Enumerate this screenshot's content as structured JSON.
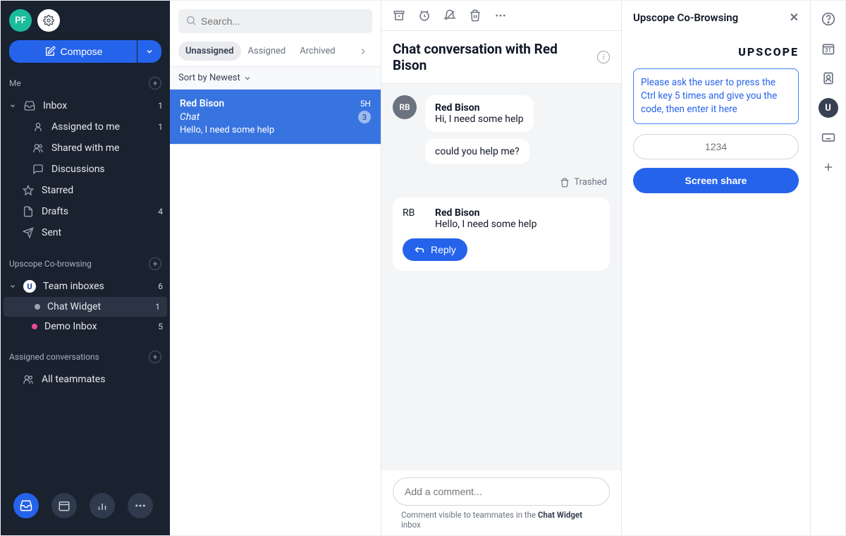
{
  "user": {
    "initials": "PF"
  },
  "compose": {
    "label": "Compose"
  },
  "sections": {
    "me": {
      "title": "Me"
    },
    "cobrowse": {
      "title": "Upscope Co-browsing"
    },
    "assigned": {
      "title": "Assigned conversations"
    }
  },
  "nav": {
    "inbox": {
      "label": "Inbox",
      "count": "1"
    },
    "assigned_to_me": {
      "label": "Assigned to me",
      "count": "1"
    },
    "shared_with_me": {
      "label": "Shared with me"
    },
    "discussions": {
      "label": "Discussions"
    },
    "starred": {
      "label": "Starred"
    },
    "drafts": {
      "label": "Drafts",
      "count": "4"
    },
    "sent": {
      "label": "Sent"
    },
    "team_inboxes": {
      "label": "Team inboxes",
      "count": "6"
    },
    "chat_widget": {
      "label": "Chat Widget",
      "count": "1"
    },
    "demo_inbox": {
      "label": "Demo Inbox",
      "count": "5"
    },
    "all_teammates": {
      "label": "All teammates"
    }
  },
  "list": {
    "search_placeholder": "Search...",
    "tabs": {
      "unassigned": "Unassigned",
      "assigned": "Assigned",
      "archived": "Archived"
    },
    "sort_label": "Sort by Newest",
    "items": [
      {
        "name": "Red Bison",
        "time": "5H",
        "channel": "Chat",
        "badge": "3",
        "preview": "Hello, I need some help"
      }
    ]
  },
  "conversation": {
    "title": "Chat conversation with Red Bison",
    "trashed_label": "Trashed",
    "m1": {
      "sender": "Red Bison",
      "avatar": "RB",
      "text": "Hi, I need some help"
    },
    "m1_followup": "could you help me?",
    "m2": {
      "sender": "Red Bison",
      "avatar": "RB",
      "text": "Hello, I need some help"
    },
    "reply_label": "Reply",
    "comment_placeholder": "Add a comment...",
    "footer_hint_pre": "Comment visible to teammates in the ",
    "footer_hint_bold": "Chat Widget",
    "footer_hint_post": " inbox"
  },
  "upscope": {
    "title": "Upscope Co-Browsing",
    "logo": "UPSCOPE",
    "instruction": "Please ask the user to press the Ctrl key 5 times and give you the code, then enter it here",
    "code_placeholder": "1234",
    "share_label": "Screen share"
  },
  "rail": {
    "calendar_day": "31"
  }
}
